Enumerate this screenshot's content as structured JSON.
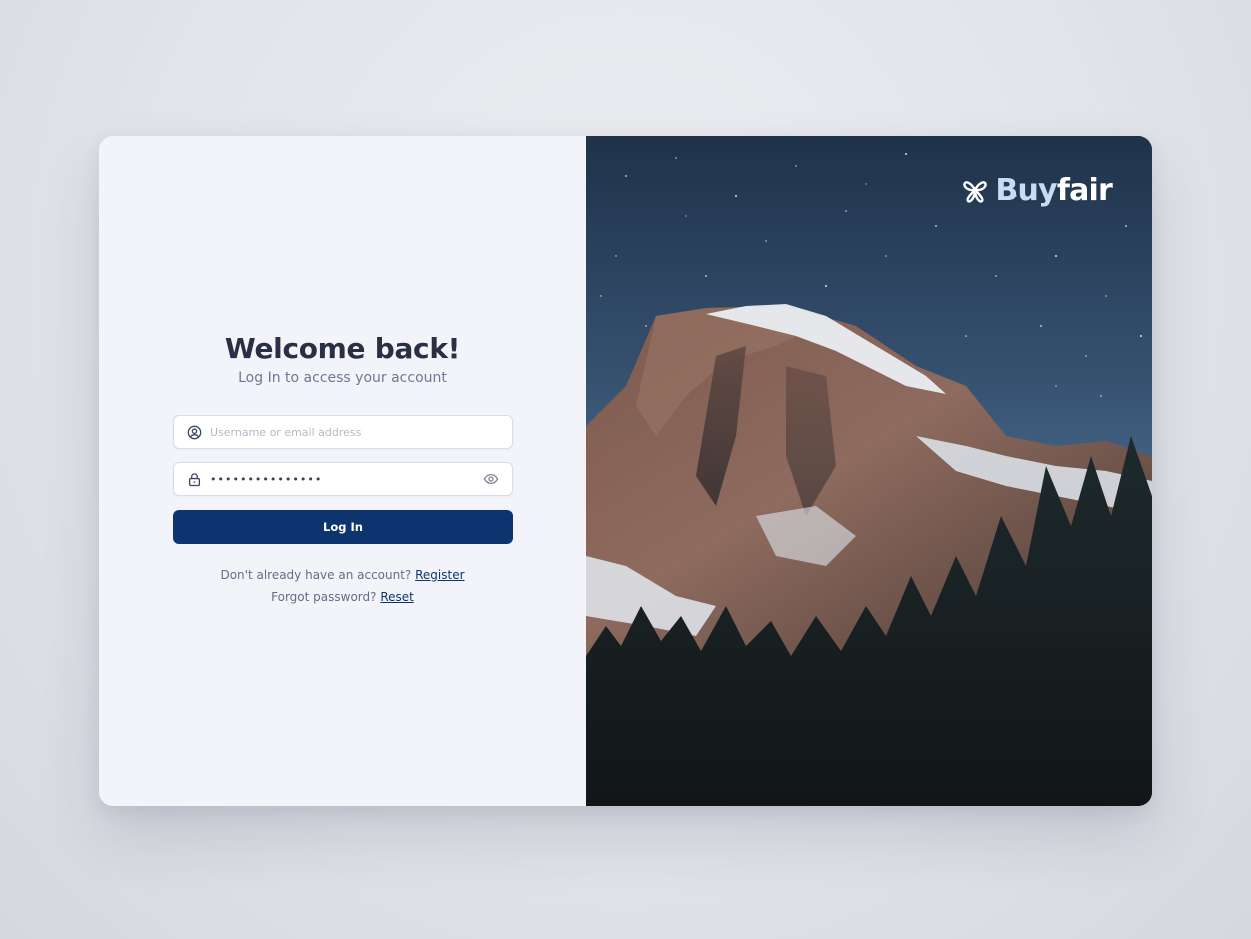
{
  "login": {
    "heading": "Welcome back!",
    "subheading": "Log In to access your account",
    "username_placeholder": "Username or email address",
    "password_value": "•••••••••••••••",
    "login_button": "Log In",
    "register_prompt": "Don't already have an account?",
    "register_link": "Register",
    "reset_prompt": "Forgot password?",
    "reset_link": "Reset"
  },
  "brand": {
    "name_part1": "Buy",
    "name_part2": "fair",
    "logo_icon": "flower-knot-icon"
  },
  "icons": {
    "user": "user-circle-icon",
    "lock": "lock-icon",
    "eye": "eye-icon"
  },
  "colors": {
    "primary": "#0e3470",
    "heading": "#2a2f45",
    "panel_bg": "#f2f4f9",
    "brand_light": "#c9dcf5"
  }
}
